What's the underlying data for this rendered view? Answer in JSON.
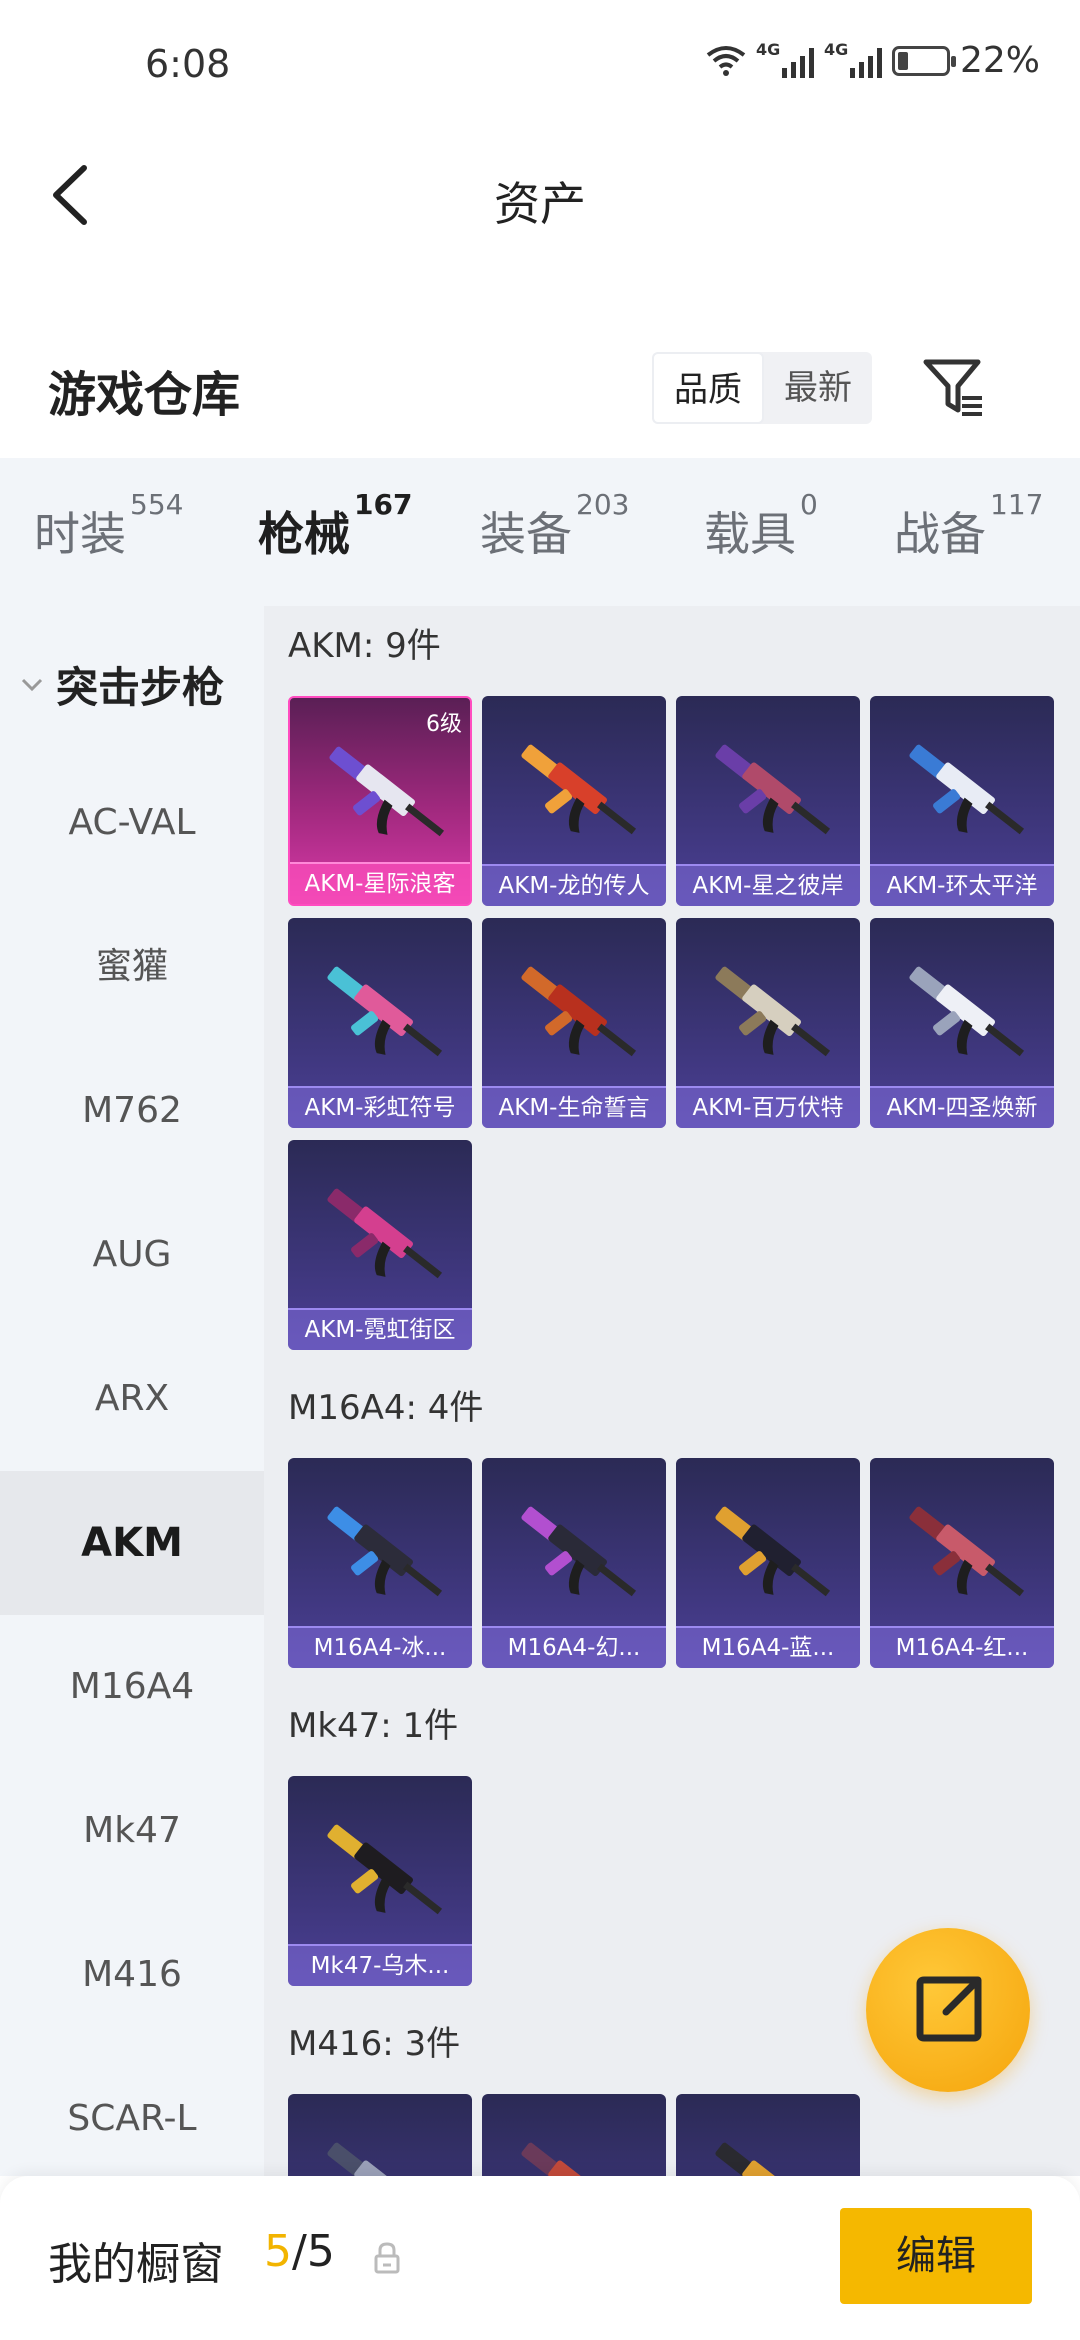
{
  "status": {
    "time": "6:08",
    "net1": "4G",
    "net2": "4G",
    "battery": "22%",
    "battery_level": 0.22
  },
  "nav": {
    "title": "资产"
  },
  "section": {
    "title": "游戏仓库",
    "sort_options": [
      "品质",
      "最新"
    ],
    "active_sort": "品质"
  },
  "categories": [
    {
      "label": "时装",
      "count": "554"
    },
    {
      "label": "枪械",
      "count": "167",
      "active": true
    },
    {
      "label": "装备",
      "count": "203"
    },
    {
      "label": "载具",
      "count": "0"
    },
    {
      "label": "战备",
      "count": "117"
    }
  ],
  "sidebar": {
    "group": "突击步枪",
    "items": [
      "AC-VAL",
      "蜜獾",
      "M762",
      "AUG",
      "ARX",
      "AKM",
      "M16A4",
      "Mk47",
      "M416",
      "SCAR-L"
    ],
    "active": "AKM"
  },
  "groups": [
    {
      "title": "AKM: 9件",
      "items": [
        {
          "name": "AKM-星际浪客",
          "badge": "6级",
          "rarity": "legendary",
          "colors": [
            "#e6e6f0",
            "#6d4fd1"
          ]
        },
        {
          "name": "AKM-龙的传人",
          "colors": [
            "#d8402a",
            "#f0a13a"
          ]
        },
        {
          "name": "AKM-星之彼岸",
          "colors": [
            "#b04a6a",
            "#6a3ea8"
          ]
        },
        {
          "name": "AKM-环太平洋",
          "colors": [
            "#e8ecf5",
            "#3a7bd5"
          ]
        },
        {
          "name": "AKM-彩虹符号",
          "colors": [
            "#e05a9a",
            "#4ac1d6"
          ]
        },
        {
          "name": "AKM-生命誓言",
          "colors": [
            "#b8301e",
            "#d2692a"
          ]
        },
        {
          "name": "AKM-百万伏特",
          "colors": [
            "#d6cfbf",
            "#8c7a5a"
          ]
        },
        {
          "name": "AKM-四圣焕新",
          "colors": [
            "#eef0f6",
            "#9aa3bb"
          ]
        },
        {
          "name": "AKM-霓虹街区",
          "colors": [
            "#d43f8f",
            "#8a2a6a"
          ]
        }
      ]
    },
    {
      "title": "M16A4: 4件",
      "items": [
        {
          "name": "M16A4-冰...",
          "colors": [
            "#2c2c3a",
            "#3d8ee6"
          ]
        },
        {
          "name": "M16A4-幻...",
          "colors": [
            "#2a2a38",
            "#b24fd0"
          ]
        },
        {
          "name": "M16A4-蓝...",
          "colors": [
            "#202030",
            "#e0a030"
          ]
        },
        {
          "name": "M16A4-红...",
          "colors": [
            "#c85a6a",
            "#8a2f3a"
          ]
        }
      ]
    },
    {
      "title": "Mk47: 1件",
      "items": [
        {
          "name": "Mk47-乌木...",
          "colors": [
            "#1e1c20",
            "#e0b030"
          ]
        }
      ]
    },
    {
      "title": "M416: 3件",
      "items": [
        {
          "name": "",
          "colors": [
            "#9aa0b8",
            "#4a4f6a"
          ]
        },
        {
          "name": "",
          "colors": [
            "#c24a3a",
            "#6a3a5a"
          ]
        },
        {
          "name": "",
          "colors": [
            "#e0a030",
            "#2a2a30"
          ]
        }
      ]
    }
  ],
  "bottom": {
    "label": "我的橱窗",
    "current": "5",
    "sep": "/",
    "total": "5",
    "edit_label": "编辑"
  },
  "colors": {
    "accent": "#f5b800",
    "legendary": "#d93aa8",
    "rare": "#4b3f95"
  }
}
